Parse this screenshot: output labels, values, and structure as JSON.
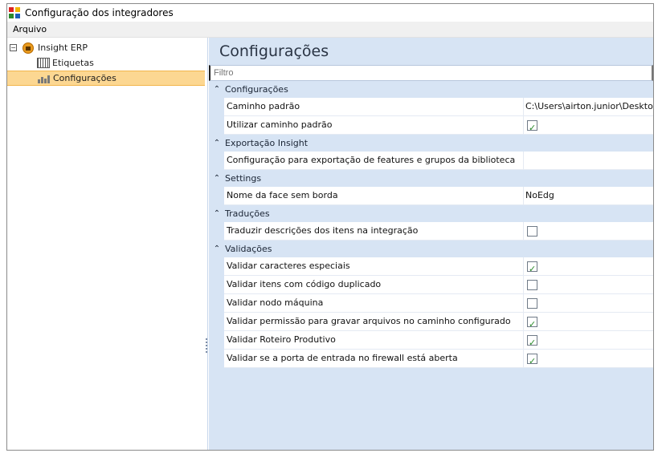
{
  "window": {
    "title": "Configuração dos integradores"
  },
  "menu": {
    "items": [
      "Arquivo"
    ]
  },
  "tree": {
    "root": {
      "label": "Insight ERP",
      "expander": "−"
    },
    "children": [
      {
        "label": "Etiquetas",
        "selected": false
      },
      {
        "label": "Configurações",
        "selected": true
      }
    ]
  },
  "panel": {
    "header": "Configurações",
    "filter_placeholder": "Filtro"
  },
  "groups": [
    {
      "title": "Configurações",
      "rows": [
        {
          "name": "Caminho padrão",
          "value": "C:\\Users\\airton.junior\\Desktop",
          "type": "text"
        },
        {
          "name": "Utilizar caminho padrão",
          "checked": true,
          "type": "checkbox"
        }
      ]
    },
    {
      "title": "Exportação Insight",
      "rows": [
        {
          "name": "Configuração para exportação de features e grupos da biblioteca",
          "value": "",
          "type": "text"
        }
      ]
    },
    {
      "title": "Settings",
      "rows": [
        {
          "name": "Nome da face sem borda",
          "value": "NoEdg",
          "type": "text"
        }
      ]
    },
    {
      "title": "Traduções",
      "rows": [
        {
          "name": "Traduzir descrições dos itens na integração",
          "checked": false,
          "type": "checkbox"
        }
      ]
    },
    {
      "title": "Validações",
      "rows": [
        {
          "name": "Validar caracteres especiais",
          "checked": true,
          "type": "checkbox"
        },
        {
          "name": "Validar itens com código duplicado",
          "checked": false,
          "type": "checkbox"
        },
        {
          "name": "Validar nodo máquina",
          "checked": false,
          "type": "checkbox"
        },
        {
          "name": "Validar permissão para gravar arquivos no caminho configurado",
          "checked": true,
          "type": "checkbox"
        },
        {
          "name": "Validar Roteiro Produtivo",
          "checked": true,
          "type": "checkbox"
        },
        {
          "name": "Validar se a porta de entrada no firewall está aberta",
          "checked": true,
          "type": "checkbox"
        }
      ]
    }
  ],
  "colors": {
    "panel_bg": "#d7e4f4",
    "selection": "#fcd792",
    "check": "#2a8a2a"
  }
}
